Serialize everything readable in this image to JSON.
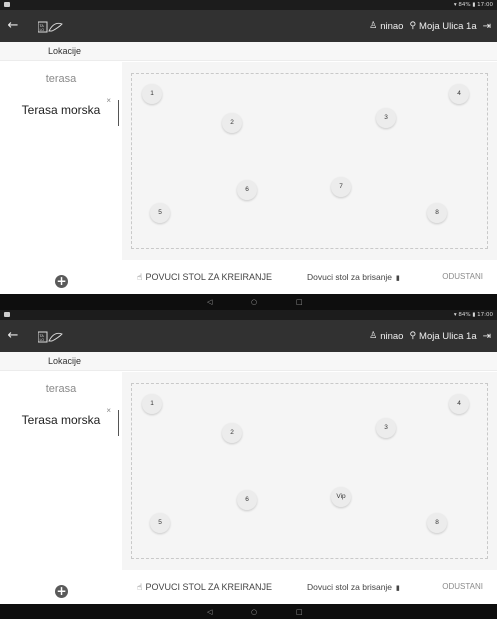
{
  "status_bar": {
    "time": "17:00",
    "battery": "84%",
    "status_text": "▾ 84% ▮ 17:00"
  },
  "app_bar": {
    "back_icon": "arrow-left-icon",
    "logo_icon": "app-logo-icon",
    "user": "ninao",
    "address": "Moja Ulica 1a",
    "logout_icon": "logout-icon"
  },
  "subheader": {
    "label": "Lokacije"
  },
  "sidebar": {
    "locations": [
      "terasa",
      "Terasa morska"
    ],
    "close_glyph": "×",
    "add_icon": "plus-circle-icon"
  },
  "actions": {
    "pull_label": "POVUCI STOL ZA KREIRANJE",
    "drop_label": "Dovuci stol za brisanje",
    "cancel_label": "ODUSTANI"
  },
  "nav": {
    "back": "◁",
    "home": "○",
    "recents": "□"
  },
  "screens": [
    {
      "tables": [
        "1",
        "2",
        "3",
        "4",
        "5",
        "6",
        "7",
        "8"
      ]
    },
    {
      "tables": [
        "1",
        "2",
        "3",
        "4",
        "5",
        "6",
        "Vip",
        "8"
      ]
    }
  ]
}
